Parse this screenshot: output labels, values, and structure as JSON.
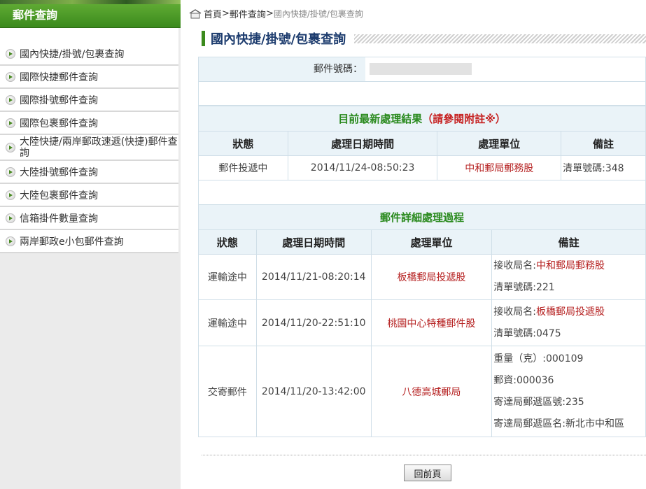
{
  "sidebar": {
    "title": "郵件查詢",
    "items": [
      {
        "label": "國內快捷/掛號/包裹查詢"
      },
      {
        "label": "國際快捷郵件查詢"
      },
      {
        "label": "國際掛號郵件查詢"
      },
      {
        "label": "國際包裹郵件查詢"
      },
      {
        "label": "大陸快捷/兩岸郵政速遞(快捷)郵件查詢"
      },
      {
        "label": "大陸掛號郵件查詢"
      },
      {
        "label": "大陸包裹郵件查詢"
      },
      {
        "label": "信箱掛件數量查詢"
      },
      {
        "label": "兩岸郵政e小包郵件查詢"
      }
    ]
  },
  "breadcrumb": {
    "home": "首頁",
    "sep": ">",
    "section": "郵件查詢",
    "current": "國內快捷/掛號/包裹查詢"
  },
  "page_title": "國內快捷/掛號/包裹查詢",
  "search": {
    "label": "郵件號碼："
  },
  "latest": {
    "caption": "目前最新處理結果",
    "caption_note": "（請參閱附註※）",
    "headers": [
      "狀態",
      "處理日期時間",
      "處理單位",
      "備註"
    ],
    "row": {
      "status": "郵件投遞中",
      "datetime": "2014/11/24-08:50:23",
      "unit": "中和郵局郵務股",
      "remark": "清單號碼:348"
    }
  },
  "detail": {
    "caption": "郵件詳細處理過程",
    "headers": [
      "狀態",
      "處理日期時間",
      "處理單位",
      "備註"
    ],
    "rows": [
      {
        "status": "運輸途中",
        "datetime": "2014/11/21-08:20:14",
        "unit": "板橋郵局投遞股",
        "remark_label": "接收局名:",
        "remark_value": "中和郵局郵務股",
        "remark2": "清單號碼:221"
      },
      {
        "status": "運輸途中",
        "datetime": "2014/11/20-22:51:10",
        "unit": "桃園中心特種郵件股",
        "remark_label": "接收局名:",
        "remark_value": "板橋郵局投遞股",
        "remark2": "清單號碼:0475"
      },
      {
        "status": "交寄郵件",
        "datetime": "2014/11/20-13:42:00",
        "unit": "八德高城郵局",
        "remarks": [
          "重量（克）:000109",
          "郵資:000036",
          "寄達局郵遞區號:235",
          "寄達局郵遞區名:新北市中和區"
        ]
      }
    ]
  },
  "back_button": "回前頁",
  "colors": {
    "accent_green": "#3b8a1d",
    "header_bg": "#eaf3f8",
    "red_text": "#b62222",
    "title_blue": "#1d3c6e"
  }
}
